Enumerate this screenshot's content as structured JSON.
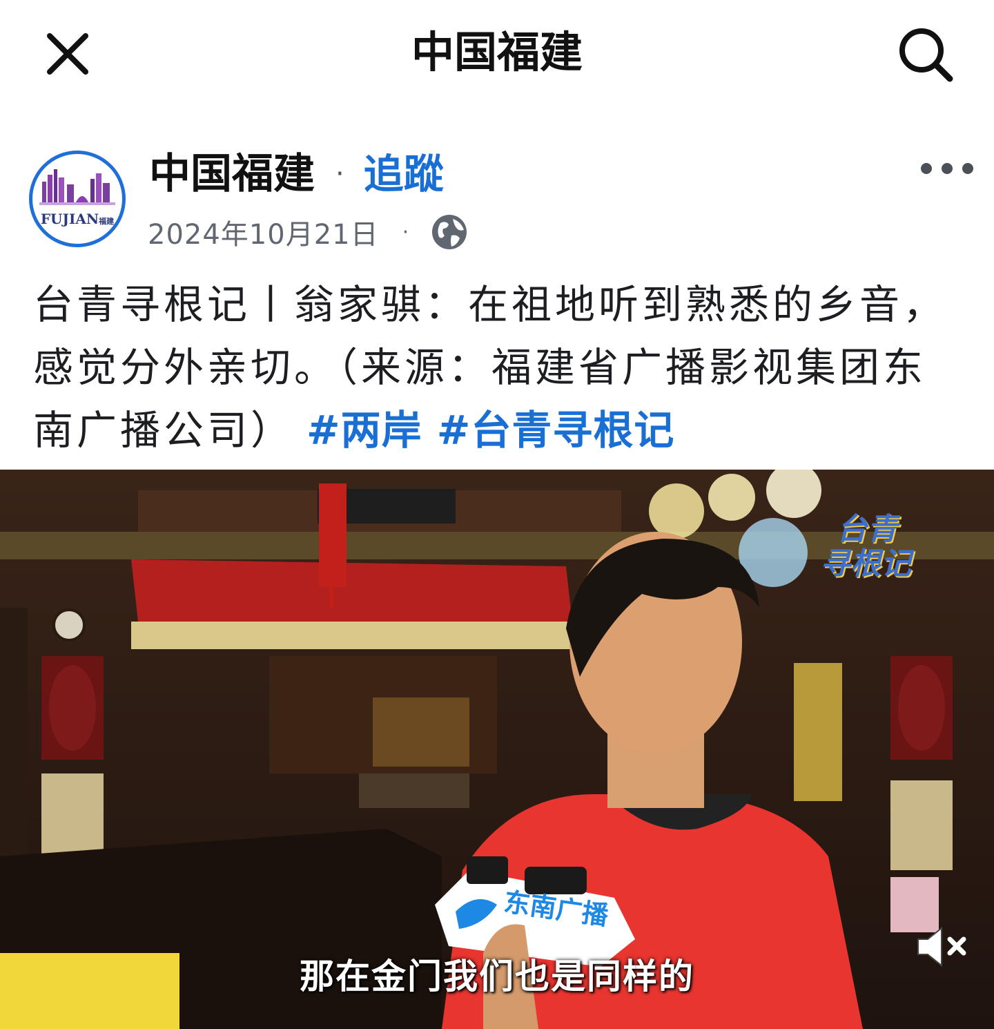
{
  "header": {
    "title": "中国福建",
    "close_icon": "close-icon",
    "search_icon": "search-icon"
  },
  "post": {
    "avatar_logo_text": "FUJIAN",
    "avatar_logo_cn": "福建",
    "author": "中国福建",
    "separator": "·",
    "follow_label": "追蹤",
    "date": "2024年10月21日",
    "meta_separator": "·",
    "privacy_icon": "globe-icon",
    "more_icon": "more-icon",
    "text": "台青寻根记丨翁家骐：在祖地听到熟悉的乡音，感觉分外亲切。（来源：福建省广播影视集团东南广播公司）",
    "hashtags": "#两岸  #台青寻根记"
  },
  "video": {
    "watermark_line1": "台青",
    "watermark_line2": "寻根记",
    "mic_label": "东南广播",
    "subtitle": "那在金门我们也是同样的",
    "mute_icon": "mute-icon"
  },
  "colors": {
    "accent_blue": "#1a6fd4",
    "avatar_ring": "#1f6fd8",
    "shirt_red": "#e8352f"
  }
}
